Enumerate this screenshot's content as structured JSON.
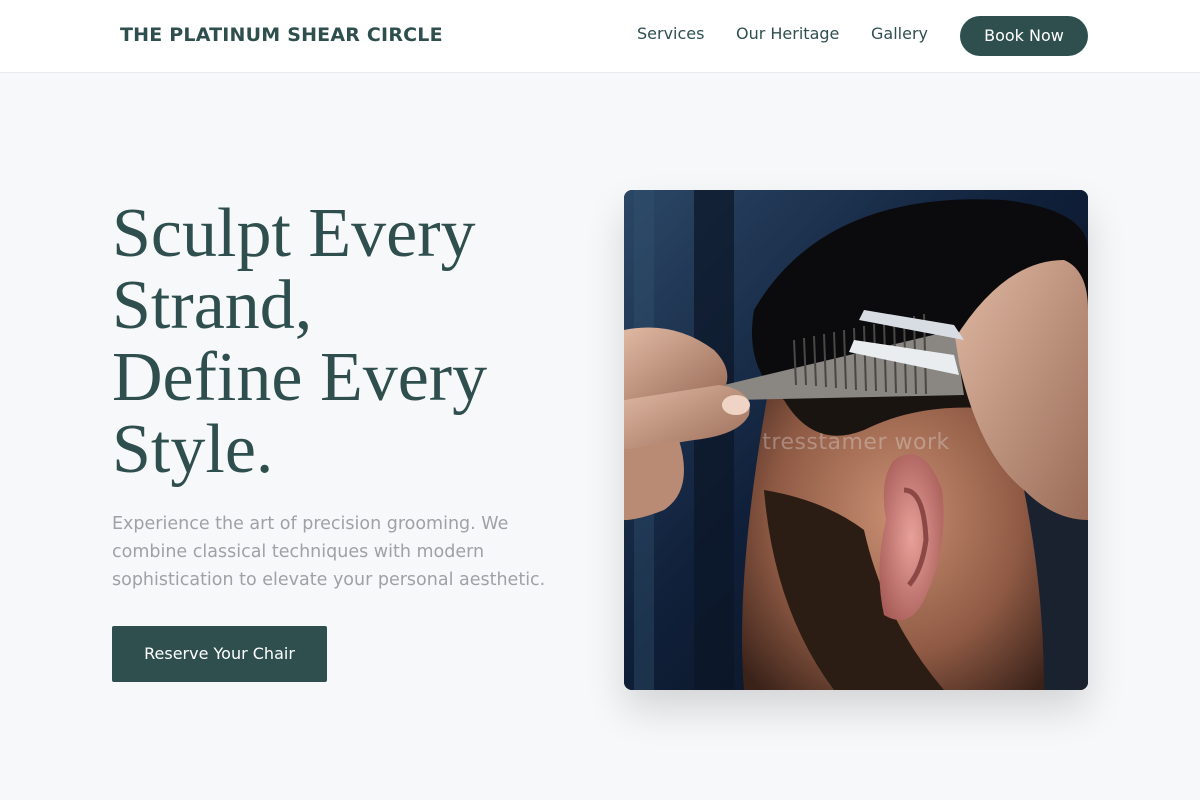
{
  "header": {
    "brand": "THE PLATINUM SHEAR CIRCLE",
    "nav": {
      "services": "Services",
      "heritage": "Our Heritage",
      "gallery": "Gallery"
    },
    "book_button": "Book Now"
  },
  "hero": {
    "title_lines": [
      "Sculpt Every",
      "Strand,",
      "Define Every",
      "Style."
    ],
    "description": "Experience the art of precision grooming. We combine classical techniques with modern sophistication to elevate your personal aesthetic.",
    "cta": "Reserve Your Chair",
    "image": {
      "watermark": "tresstamer work",
      "subject": "barber-cutting-hair-photo"
    }
  },
  "colors": {
    "primary": "#2f4f4f",
    "background": "#f7f8fa",
    "muted_text": "#9ea1a6"
  }
}
